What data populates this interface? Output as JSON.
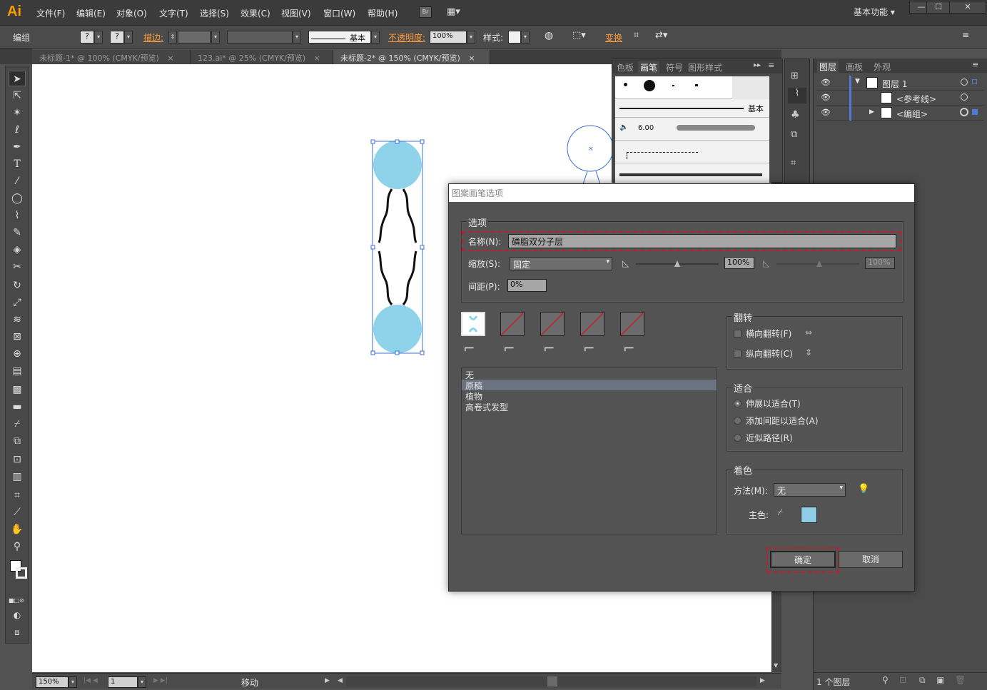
{
  "app": {
    "logo": "Ai",
    "workspace": "基本功能"
  },
  "menu": [
    "文件(F)",
    "编辑(E)",
    "对象(O)",
    "文字(T)",
    "选择(S)",
    "效果(C)",
    "视图(V)",
    "窗口(W)",
    "帮助(H)"
  ],
  "bridge_label": "Br",
  "control": {
    "selection": "编组",
    "stroke_label": "描边:",
    "brush_name": "基本",
    "opacity_label": "不透明度:",
    "opacity_value": "100%",
    "style_label": "样式:",
    "transform_label": "变换"
  },
  "tabs": [
    {
      "label": "未标题-1* @ 100% (CMYK/预览)",
      "close": "×"
    },
    {
      "label": "123.ai* @ 25% (CMYK/预览)",
      "close": "×"
    },
    {
      "label": "未标题-2* @ 150% (CMYK/预览)",
      "close": "×",
      "active": true
    }
  ],
  "status": {
    "zoom": "150%",
    "page": "1",
    "tool": "移动"
  },
  "brush_panel": {
    "tabs": [
      "色板",
      "画笔",
      "符号",
      "图形样式"
    ],
    "basic_label": "基本",
    "brush_size": "6.00"
  },
  "layers_panel": {
    "tabs": [
      "图层",
      "画板",
      "外观"
    ],
    "rows": [
      {
        "name": "图层 1"
      },
      {
        "name": "<参考线>"
      },
      {
        "name": "<编组>"
      }
    ],
    "footer": "1 个图层"
  },
  "dialog": {
    "title": "图案画笔选项",
    "options_label": "选项",
    "name_label": "名称(N):",
    "name_value": "磷脂双分子层",
    "scale_label": "缩放(S):",
    "scale_mode": "固定",
    "scale_value": "100%",
    "scale_value2": "100%",
    "spacing_label": "间距(P):",
    "spacing_value": "0%",
    "flip_label": "翻转",
    "flip_h": "横向翻转(F)",
    "flip_v": "纵向翻转(C)",
    "fit_label": "适合",
    "fit_options": [
      "伸展以适合(T)",
      "添加间距以适合(A)",
      "近似路径(R)"
    ],
    "colorize_label": "着色",
    "method_label": "方法(M):",
    "method_value": "无",
    "key_color_label": "主色:",
    "key_color": "#8fcde6",
    "pattern_list": [
      "无",
      "原稿",
      "植物",
      "高卷式发型"
    ],
    "ok": "确定",
    "cancel": "取消"
  },
  "colors": {
    "accent": "#ff9a00",
    "circle_fill": "#8fd3ea",
    "selection": "#3a6fd8",
    "highlight": "#c21d2e"
  }
}
